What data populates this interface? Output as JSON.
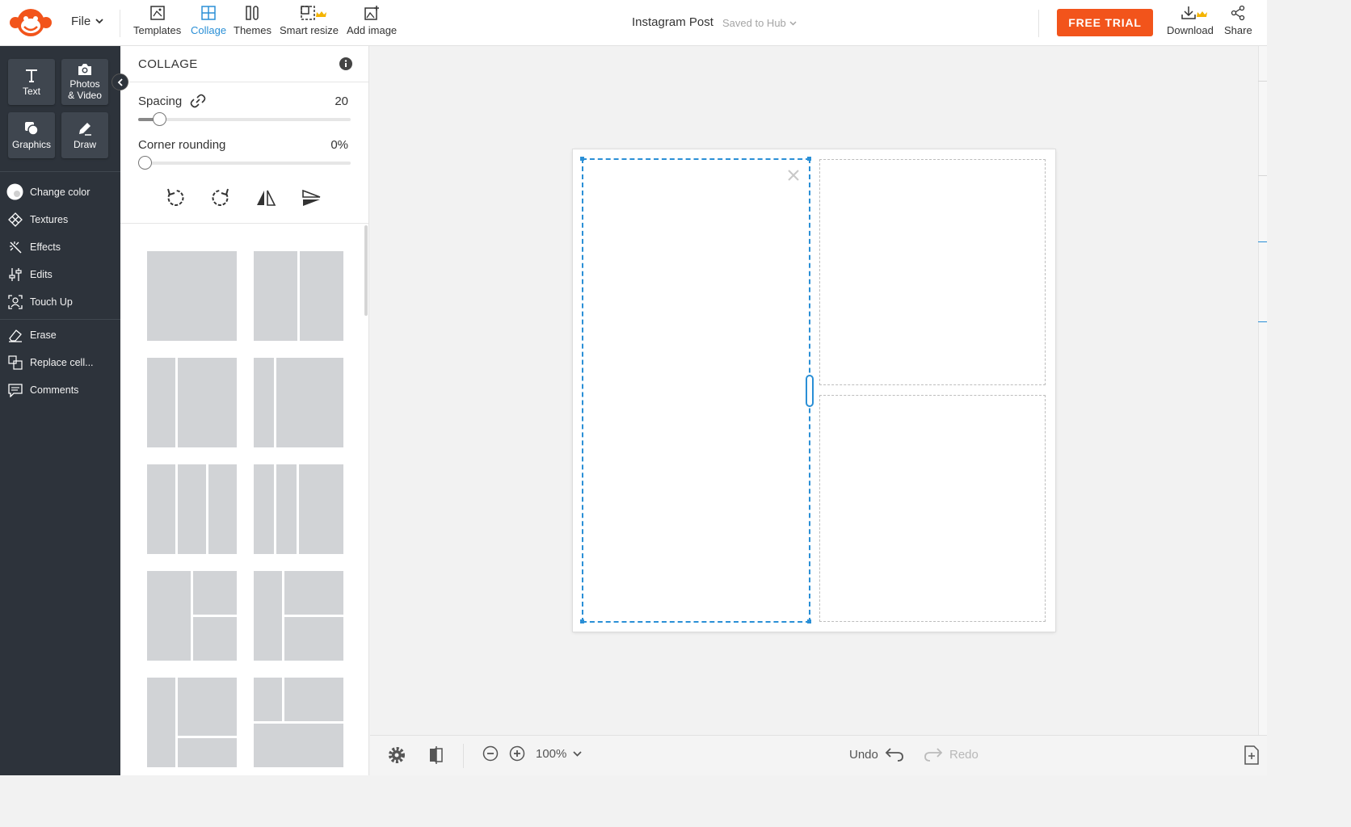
{
  "app": {
    "file_menu": "File",
    "document_title": "Instagram Post",
    "save_status": "Saved to Hub",
    "trial_button": "FREE TRIAL",
    "accent_color": "#2a8fd6",
    "brand_color": "#f2541b"
  },
  "toolbar": {
    "templates": "Templates",
    "collage": "Collage",
    "themes": "Themes",
    "smart_resize": "Smart resize",
    "add_image": "Add image",
    "download": "Download",
    "share": "Share"
  },
  "rail": {
    "text": "Text",
    "photos_line1": "Photos",
    "photos_line2": "& Video",
    "graphics": "Graphics",
    "draw": "Draw",
    "items": [
      {
        "label": "Change color",
        "icon": "color-circle-icon"
      },
      {
        "label": "Textures",
        "icon": "textures-icon"
      },
      {
        "label": "Effects",
        "icon": "magic-wand-icon"
      },
      {
        "label": "Edits",
        "icon": "sliders-icon"
      },
      {
        "label": "Touch Up",
        "icon": "face-scan-icon"
      },
      {
        "label": "Erase",
        "icon": "eraser-icon"
      },
      {
        "label": "Replace cell...",
        "icon": "replace-icon"
      },
      {
        "label": "Comments",
        "icon": "comment-icon"
      }
    ]
  },
  "panel": {
    "title": "COLLAGE",
    "spacing_label": "Spacing",
    "spacing_value": "20",
    "spacing_level": 0.1,
    "corner_label": "Corner rounding",
    "corner_value": "0%",
    "corner_level": 0
  },
  "bottom": {
    "zoom": "100%",
    "undo": "Undo",
    "redo": "Redo"
  }
}
